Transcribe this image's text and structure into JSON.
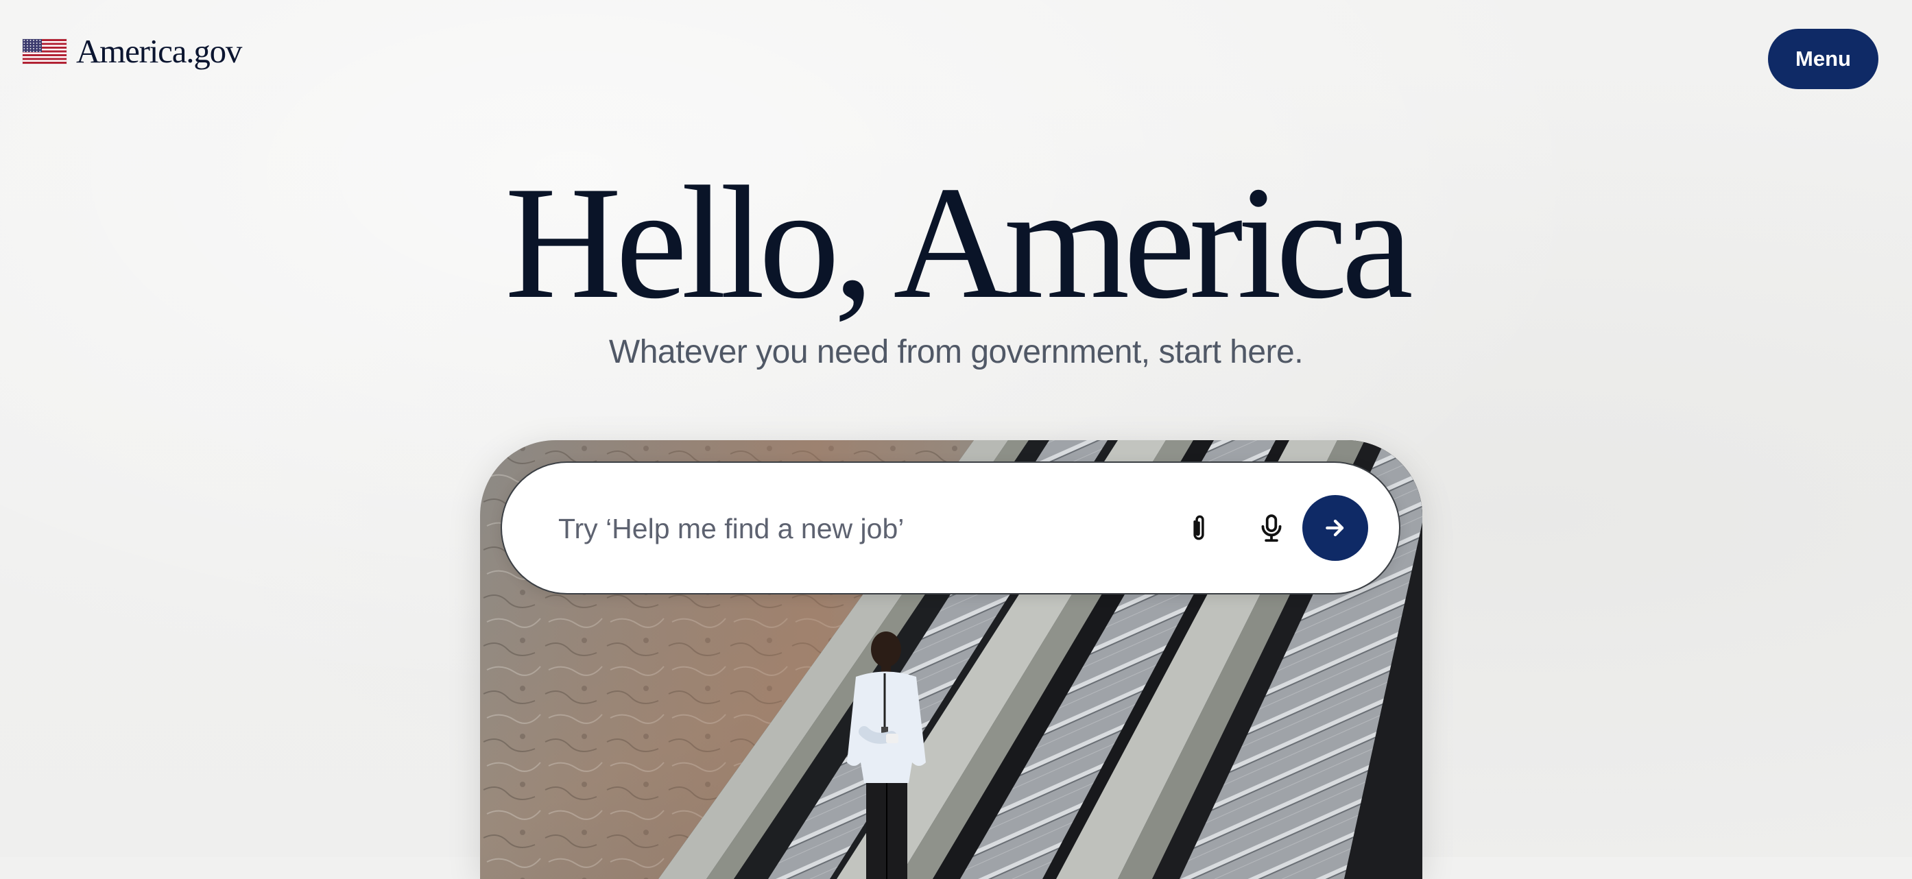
{
  "header": {
    "brand_name": "America.gov",
    "menu_label": "Menu"
  },
  "hero": {
    "title": "Hello, America",
    "subtitle": "Whatever you need from government, start here."
  },
  "search": {
    "placeholder": "Try ‘Help me find a new job’",
    "value": "",
    "icons": {
      "attach": "paperclip-icon",
      "voice": "microphone-icon",
      "submit": "arrow-right-icon"
    }
  },
  "colors": {
    "primary": "#0f2a66",
    "heading": "#0a1428",
    "subtitle": "#505866",
    "background": "#f1f1f0"
  }
}
